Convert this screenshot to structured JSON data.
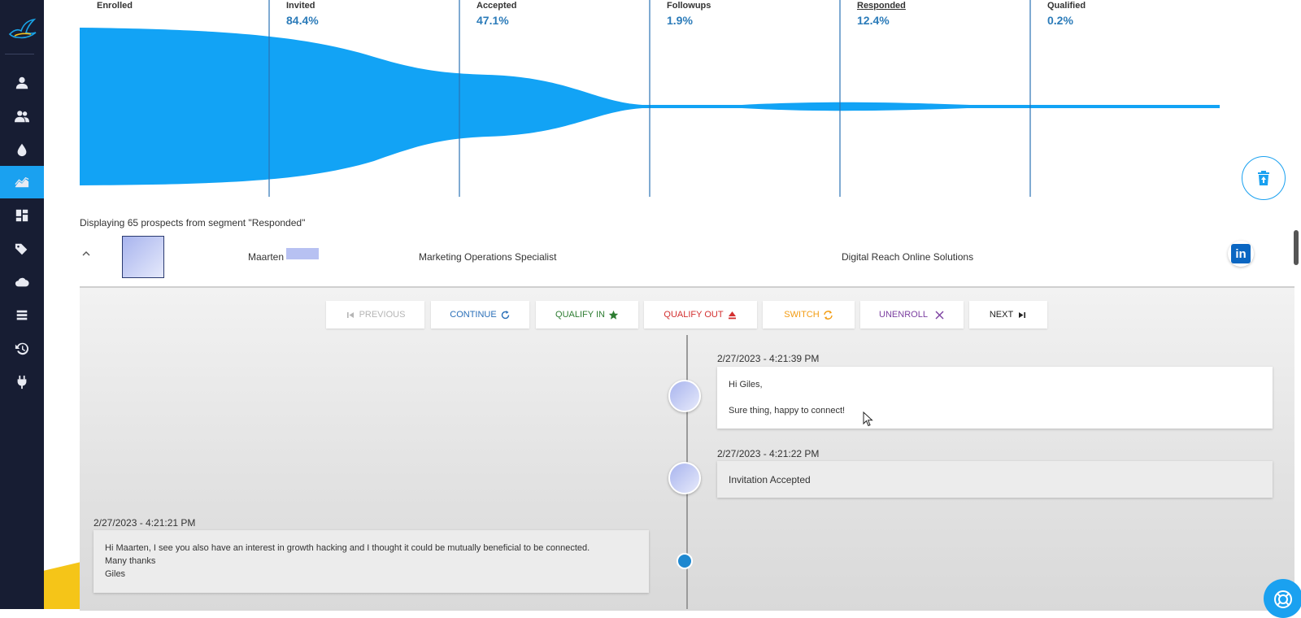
{
  "sidebar": {
    "items": [
      {
        "icon": "person-icon"
      },
      {
        "icon": "people-icon"
      },
      {
        "icon": "drop-icon"
      },
      {
        "icon": "chart-area-icon",
        "active": true
      },
      {
        "icon": "dashboard-icon"
      },
      {
        "icon": "tag-icon"
      },
      {
        "icon": "cloud-icon"
      },
      {
        "icon": "list-icon"
      },
      {
        "icon": "history-icon"
      },
      {
        "icon": "plug-icon"
      }
    ]
  },
  "funnel": {
    "stages": [
      {
        "name": "Enrolled",
        "pct": ""
      },
      {
        "name": "Invited",
        "pct": "84.4%"
      },
      {
        "name": "Accepted",
        "pct": "47.1%"
      },
      {
        "name": "Followups",
        "pct": "1.9%"
      },
      {
        "name": "Responded",
        "pct": "12.4%"
      },
      {
        "name": "Qualified",
        "pct": "0.2%"
      }
    ],
    "color": "#12a3f5"
  },
  "segment_text": "Displaying 65 prospects from segment \"Responded\"",
  "prospect": {
    "first_name": "Maarten",
    "title": "Marketing Operations Specialist",
    "company": "Digital Reach Online Solutions",
    "linkedin_label": "in"
  },
  "actions": {
    "previous": "PREVIOUS",
    "continue": "CONTINUE",
    "qualify_in": "QUALIFY IN",
    "qualify_out": "QUALIFY OUT",
    "switch": "SWITCH",
    "unenroll": "UNENROLL",
    "next": "NEXT"
  },
  "timeline": {
    "msg1": {
      "ts": "2/27/2023 - 4:21:39 PM",
      "line1": "Hi Giles,",
      "line2": "Sure thing, happy to connect!"
    },
    "msg2": {
      "ts": "2/27/2023 - 4:21:22 PM",
      "text": "Invitation Accepted"
    },
    "msg3": {
      "ts": "2/27/2023 - 4:21:21 PM",
      "line1": "Hi Maarten, I see you also have an interest in growth hacking and I thought it could be mutually beneficial to be connected.",
      "line2": "Many thanks",
      "line3": "Giles"
    }
  }
}
